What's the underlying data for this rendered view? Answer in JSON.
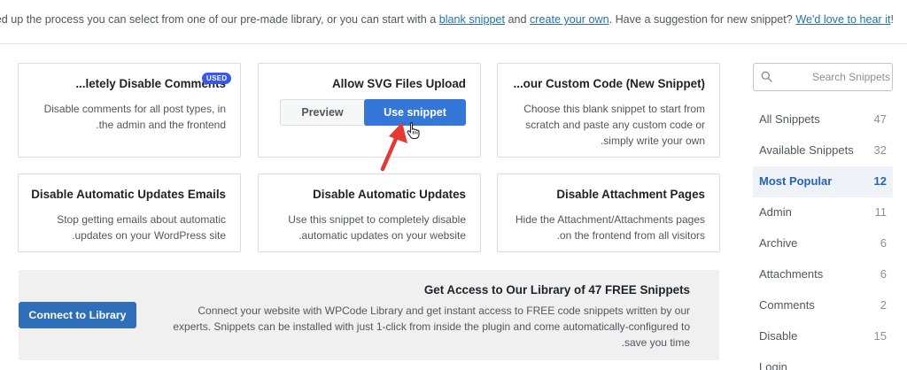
{
  "notice": {
    "text_start": "!To speed up the process you can select from one of our pre-made library, or you can start with a ",
    "link_blank": "blank snippet",
    "text_and": " and ",
    "link_create": "create your own",
    "text_suggest": ". Have a suggestion for new snippet? ",
    "link_hear": "We'd love to hear it"
  },
  "cards": [
    {
      "title": "...letely Disable Comments",
      "desc": "Disable comments for all post types, in the admin and the frontend.",
      "badge": "USED"
    },
    {
      "title": "Allow SVG Files Upload",
      "preview_label": "Preview",
      "use_label": "Use snippet"
    },
    {
      "title": "...our Custom Code (New Snippet)",
      "desc": "Choose this blank snippet to start from scratch and paste any custom code or simply write your own."
    },
    {
      "title": "Disable Automatic Updates Emails",
      "desc": "Stop getting emails about automatic updates on your WordPress site."
    },
    {
      "title": "Disable Automatic Updates",
      "desc": "Use this snippet to completely disable automatic updates on your website."
    },
    {
      "title": "Disable Attachment Pages",
      "desc": "Hide the Attachment/Attachments pages on the frontend from all visitors."
    }
  ],
  "banner": {
    "title": "Get Access to Our Library of 47 FREE Snippets",
    "desc": "Connect your website with WPCode Library and get instant access to FREE code snippets written by our experts. Snippets can be installed with just 1-click from inside the plugin and come automatically-configured to save you time.",
    "button": "Connect to Library"
  },
  "sidebar": {
    "search_placeholder": "Search Snippets",
    "categories": [
      {
        "name": "All Snippets",
        "count": "47"
      },
      {
        "name": "Available Snippets",
        "count": "32"
      },
      {
        "name": "Most Popular",
        "count": "12",
        "active": true
      },
      {
        "name": "Admin",
        "count": "11"
      },
      {
        "name": "Archive",
        "count": "6"
      },
      {
        "name": "Attachments",
        "count": "6"
      },
      {
        "name": "Comments",
        "count": "2"
      },
      {
        "name": "Disable",
        "count": "15"
      },
      {
        "name": "Login",
        "count": ""
      }
    ]
  },
  "colors": {
    "accent": "#3477d8",
    "badge": "#3858e9",
    "arrow": "#e53935",
    "active_bg": "#eff3f8"
  },
  "icons": {
    "search": "search-icon",
    "arrow": "red-arrow-icon",
    "cursor": "hand-pointer-icon"
  }
}
